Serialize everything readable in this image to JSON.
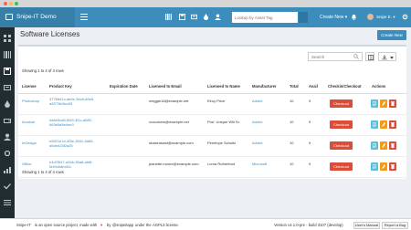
{
  "app": {
    "brand": "Snipe-IT Demo"
  },
  "header": {
    "search_placeholder": "Lookup by Asset Tag",
    "create_new": "Create New ▾",
    "user_name": "Snipe E. ▾"
  },
  "page": {
    "title": "Software Licenses",
    "create_button": "Create New"
  },
  "table": {
    "search_placeholder": "Search",
    "showing_top": "Showing 1 to 4 of 4 rows",
    "showing_bottom": "Showing 1 to 4 of 4 rows",
    "columns": [
      "License",
      "Product Key",
      "Expiration Date",
      "Licensed to Email",
      "Licensed to Name",
      "Manufacturer",
      "Total",
      "Avail",
      "Checkin/Checkout",
      "Actions"
    ],
    "checkout_label": "Checkout",
    "rows": [
      {
        "license": "Photoshop",
        "key1": "3776b61c-ab0e-36c8-a9e5-",
        "key2": "a3f776b5cc55",
        "expiration": "",
        "email": "meggie18@example.net",
        "name": "Elroy Price",
        "manufacturer": "Adobe",
        "total": "10",
        "avail": "9"
      },
      {
        "license": "Acrobat",
        "key1": "ea6e5cd8-f069-3f1c-a080-",
        "key2": "663e5a5e4ee3",
        "expiration": "",
        "email": "vvouckers@example.net",
        "name": "Prof. Unique Will Sr.",
        "manufacturer": "Adobe",
        "total": "10",
        "avail": "9"
      },
      {
        "license": "InDesign",
        "key1": "e5521e1e-4f5e-3541-9a65-",
        "key2": "d6ded15f2a25",
        "expiration": "",
        "email": "shakiraswst@example.com",
        "name": "Penelope Schultz",
        "manufacturer": "Adobe",
        "total": "10",
        "avail": "9"
      },
      {
        "license": "Office",
        "key1": "e4d7f647-a34b-36a8-a9df-",
        "key2": "fd49c6db4f11",
        "expiration": "",
        "email": "jeanette.moore@example.com",
        "name": "Lorna Rutherford",
        "manufacturer": "Microsoft",
        "total": "10",
        "avail": "9"
      }
    ]
  },
  "footer": {
    "snipe_it": "Snipe-IT",
    "text1": "is an open source project, made with",
    "heart": "♥",
    "text2": "by",
    "author": "@snipeitapp",
    "text3": "under the",
    "license_link": "AGPL3 license.",
    "version": "Version v4.1.0-pre - build 3107 (develop)",
    "manual_button": "User's Manual",
    "report_button": "Report a Bug"
  },
  "colors": {
    "primary": "#3c8dbc",
    "header_dark": "#367fa9",
    "sidebar": "#222d32",
    "danger": "#dd4b39",
    "info": "#5bc0de",
    "warning": "#f39c12",
    "background": "#ecf0f5"
  }
}
